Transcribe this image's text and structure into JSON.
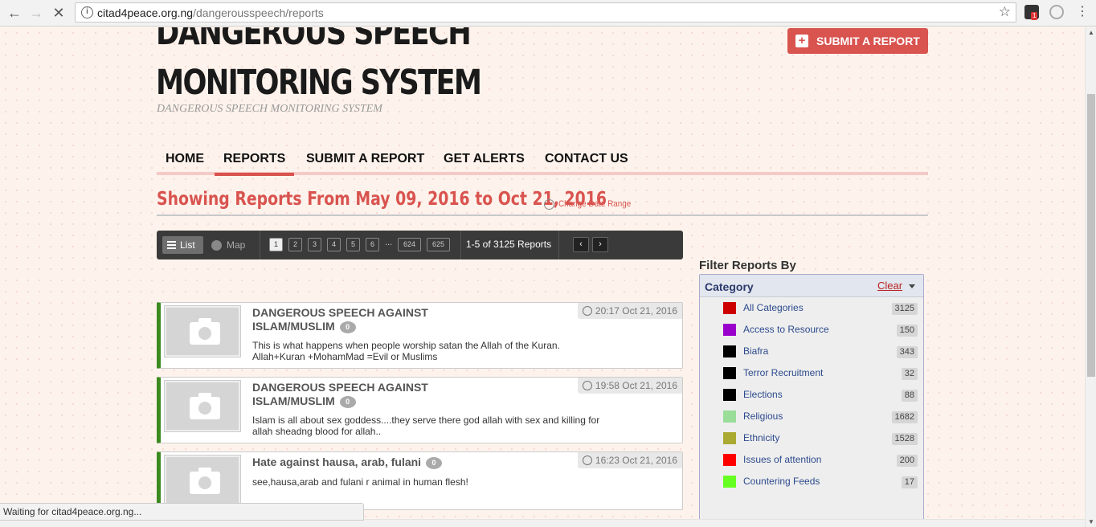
{
  "browser": {
    "url_host": "citad4peace.org.ng",
    "url_path": "/dangerousspeech/reports",
    "status_text": "Waiting for citad4peace.org.ng...",
    "ext_badge": "1"
  },
  "site": {
    "title": "DANGEROUS SPEECH MONITORING SYSTEM",
    "subtitle": "DANGEROUS SPEECH MONITORING SYSTEM",
    "submit_button": "SUBMIT A REPORT"
  },
  "nav": [
    {
      "label": "HOME"
    },
    {
      "label": "REPORTS",
      "active": true
    },
    {
      "label": "SUBMIT A REPORT"
    },
    {
      "label": "GET ALERTS"
    },
    {
      "label": "CONTACT US"
    }
  ],
  "range": {
    "heading": "Showing Reports From May 09, 2016 to Oct 21, 2016",
    "change_link": "Change Date Range"
  },
  "toolbar": {
    "list_label": "List",
    "map_label": "Map",
    "pages": [
      "1",
      "2",
      "3",
      "4",
      "5",
      "6",
      "...",
      "624",
      "625"
    ],
    "current_page": "1",
    "count_label": "1-5 of 3125 Reports",
    "prev": "‹",
    "next": "›"
  },
  "reports": [
    {
      "title": "DANGEROUS SPEECH AGAINST ISLAM/MUSLIM",
      "comments": "0",
      "date": "20:17 Oct 21, 2016",
      "text": "This is what happens when people worship satan the Allah of the Kuran. Allah+Kuran +MohamMad =Evil or Muslims"
    },
    {
      "title": "DANGEROUS SPEECH AGAINST ISLAM/MUSLIM",
      "comments": "0",
      "date": "19:58 Oct 21, 2016",
      "text": "Islam is all about sex goddess....they serve there god allah with sex and killing for allah sheadng blood for allah.."
    },
    {
      "title": "Hate against hausa, arab, fulani",
      "comments": "0",
      "date": "16:23 Oct 21, 2016",
      "text": "see,hausa,arab and fulani r animal in human flesh!"
    }
  ],
  "filter": {
    "heading": "Filter Reports By",
    "category_label": "Category",
    "clear_label": "Clear",
    "categories": [
      {
        "name": "All Categories",
        "count": "3125",
        "color": "#cc0000"
      },
      {
        "name": "Access to Resource",
        "count": "150",
        "color": "#9900cc"
      },
      {
        "name": "Biafra",
        "count": "343",
        "color": "#000000"
      },
      {
        "name": "Terror Recruitment",
        "count": "32",
        "color": "#000000"
      },
      {
        "name": "Elections",
        "count": "88",
        "color": "#000000"
      },
      {
        "name": "Religious",
        "count": "1682",
        "color": "#99dd99"
      },
      {
        "name": "Ethnicity",
        "count": "1528",
        "color": "#aaaa33"
      },
      {
        "name": "Issues of attention",
        "count": "200",
        "color": "#ff0000"
      },
      {
        "name": "Countering Feeds",
        "count": "17",
        "color": "#66ff22"
      }
    ]
  }
}
